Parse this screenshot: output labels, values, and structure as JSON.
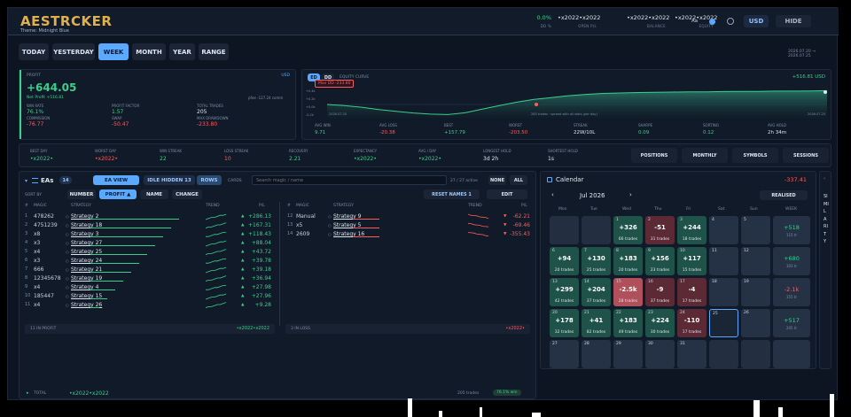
{
  "header": {
    "logo": "AESTRCKER",
    "theme": "Theme: Midnight Blue",
    "stats": [
      {
        "value": "0.0%",
        "label": "DD %",
        "color": "#3ad08a"
      },
      {
        "value": "•x2022•x2022",
        "label": "OPEN P/L",
        "color": "#dfe6f0"
      },
      {
        "value": "•x2022•x2022",
        "label": "BALANCE",
        "color": "#dfe6f0"
      },
      {
        "value": "•x2022•x2022",
        "label": "EQUITY",
        "color": "#dfe6f0"
      }
    ],
    "font_label": "Aa",
    "currency": "USD",
    "hide": "HIDE"
  },
  "periods": [
    "TODAY",
    "YESTERDAY",
    "WEEK",
    "MONTH",
    "YEAR",
    "RANGE"
  ],
  "date_range": "2026.07.20 → 2026.07.25",
  "profit": {
    "label": "PROFIT",
    "currency": "USD",
    "value": "+644.05",
    "net": "Net Profit +516.81",
    "fee": "pfee -127.24 comm",
    "metrics": [
      {
        "label": "WIN RATE",
        "value": "76.1%",
        "color": "#3ad08a"
      },
      {
        "label": "PROFIT FACTOR",
        "value": "1.57",
        "color": "#3ad08a"
      },
      {
        "label": "TOTAL TRADES",
        "value": "205",
        "color": "#dfe6f0"
      },
      {
        "label": "COMMISSION",
        "value": "-76.77",
        "color": "#ff5c5c"
      },
      {
        "label": "SWAP",
        "value": "-50.47",
        "color": "#ff5c5c"
      },
      {
        "label": "MAX DRAWDOWN",
        "value": "-233.80",
        "color": "#ff5c5c"
      }
    ]
  },
  "equity": {
    "tabs": [
      "ED",
      "DD"
    ],
    "title": "EQUITY CURVE",
    "value": "+516.81 USD",
    "maxdd": "Max DD -233.80",
    "yticks": [
      "+0.4k",
      "+0.2k",
      "+0.0k",
      "-0.2k"
    ],
    "x_left": "2026.07.20",
    "x_right": "2026.07.25",
    "note": "265 trades · spread with all stats (per day)",
    "curve": [
      0,
      -0.05,
      -0.12,
      -0.22,
      -0.3,
      -0.37,
      -0.42,
      -0.44,
      -0.36,
      -0.2,
      -0.05,
      0.1,
      0.22,
      0.3,
      0.38,
      0.44,
      0.48,
      0.5,
      0.52,
      0.53,
      0.54,
      0.55,
      0.55,
      0.56,
      0.57,
      0.57,
      0.58,
      0.58,
      0.59,
      0.6
    ],
    "stats": [
      {
        "label": "AVG WIN",
        "value": "9.71",
        "color": "#3ad08a"
      },
      {
        "label": "AVG LOSS",
        "value": "-20.38",
        "color": "#ff5c5c"
      },
      {
        "label": "BEST",
        "value": "+157.79",
        "color": "#3ad08a"
      },
      {
        "label": "WORST",
        "value": "-203.50",
        "color": "#ff5c5c"
      },
      {
        "label": "STREAK",
        "value": "22W/10L",
        "color": "#dfe6f0"
      },
      {
        "label": "SHARPE",
        "value": "0.09",
        "color": "#3ad08a"
      },
      {
        "label": "SORTINO",
        "value": "0.12",
        "color": "#3ad08a"
      },
      {
        "label": "AVG HOLD",
        "value": "2h 34m",
        "color": "#dfe6f0"
      }
    ]
  },
  "summary": [
    {
      "label": "BEST DAY",
      "value": "•x2022•",
      "color": "#3ad08a"
    },
    {
      "label": "WORST DAY",
      "value": "•x2022•",
      "color": "#ff5c5c"
    },
    {
      "label": "WIN STREAK",
      "value": "22",
      "color": "#3ad08a"
    },
    {
      "label": "LOSS STREAK",
      "value": "10",
      "color": "#ff5c5c"
    },
    {
      "label": "RECOVERY",
      "value": "2.21",
      "color": "#3ad08a"
    },
    {
      "label": "EXPECTANCY",
      "value": "•x2022•",
      "color": "#3ad08a"
    },
    {
      "label": "AVG / DAY",
      "value": "•x2022•",
      "color": "#3ad08a"
    },
    {
      "label": "LONGEST HOLD",
      "value": "3d 2h",
      "color": "#dfe6f0"
    },
    {
      "label": "SHORTEST HOLD",
      "value": "1s",
      "color": "#dfe6f0"
    }
  ],
  "summary_buttons": [
    "POSITIONS",
    "MONTHLY",
    "SYMBOLS",
    "SESSIONS"
  ],
  "eas": {
    "title": "EAs",
    "count": "14",
    "ea_view": "EA VIEW",
    "idle": "IDLE HIDDEN 13",
    "rows": "ROWS",
    "cards": "CARDS",
    "search_placeholder": "Search magic / name",
    "active": "27 / 27 active",
    "none": "NONE",
    "all": "ALL",
    "sort_label": "SORT BY",
    "sorts": [
      "NUMBER",
      "PROFIT ▲",
      "NAME",
      "CHANGE"
    ],
    "reset": "RESET NAMES 1",
    "edit": "EDIT",
    "cols": [
      "#",
      "MAGIC",
      "STRATEGY",
      "TREND",
      "P/L"
    ],
    "win": [
      {
        "n": "1",
        "magic": "478262",
        "name": "Strategy 2",
        "pl": "+286.13"
      },
      {
        "n": "2",
        "magic": "4751239",
        "name": "Strategy 18",
        "pl": "+167.31"
      },
      {
        "n": "3",
        "magic": "x8",
        "name": "Strategy 3",
        "pl": "+118.43"
      },
      {
        "n": "4",
        "magic": "x3",
        "name": "Strategy 27",
        "pl": "+88.04"
      },
      {
        "n": "5",
        "magic": "x4",
        "name": "Strategy 25",
        "pl": "+43.72"
      },
      {
        "n": "6",
        "magic": "x3",
        "name": "Strategy 24",
        "pl": "+39.78"
      },
      {
        "n": "7",
        "magic": "666",
        "name": "Strategy 21",
        "pl": "+39.18"
      },
      {
        "n": "8",
        "magic": "12345678",
        "name": "Strategy 19",
        "pl": "+36.94"
      },
      {
        "n": "9",
        "magic": "x4",
        "name": "Strategy 4",
        "pl": "+27.98"
      },
      {
        "n": "10",
        "magic": "185447",
        "name": "Strategy 15",
        "pl": "+27.96"
      },
      {
        "n": "11",
        "magic": "x4",
        "name": "Strategy 26",
        "pl": "+9.28"
      }
    ],
    "loss": [
      {
        "n": "12",
        "magic": "Manual",
        "name": "Strategy 9",
        "pl": "-62.21"
      },
      {
        "n": "13",
        "magic": "x5",
        "name": "Strategy 5",
        "pl": "-69.46"
      },
      {
        "n": "14",
        "magic": "2609",
        "name": "Strategy 16",
        "pl": "-355.43"
      }
    ],
    "in_profit": "11 IN PROFIT",
    "in_profit_val": "•x2022•x2022",
    "in_loss": "3 IN LOSS",
    "in_loss_val": "•x2022•",
    "total": "TOTAL",
    "total_val": "•x2022•x2022",
    "total_trades": "205 trades",
    "total_win": "76.1% win"
  },
  "calendar": {
    "title": "Calendar",
    "value": "-337.41",
    "month": "Jul 2026",
    "realised": "REALISED",
    "days": [
      "Mon",
      "Tue",
      "Wed",
      "Thu",
      "Fri",
      "Sat",
      "Sun",
      "WEEK"
    ],
    "weeks": [
      [
        {
          "d": "",
          "t": "x"
        },
        {
          "d": "",
          "t": "x"
        },
        {
          "d": "1",
          "p": "+326",
          "n": "66 trades",
          "t": "g"
        },
        {
          "d": "2",
          "p": "-51",
          "n": "31 trades",
          "t": "r"
        },
        {
          "d": "3",
          "p": "+244",
          "n": "18 trades",
          "t": "g"
        },
        {
          "d": "4",
          "t": "e"
        },
        {
          "d": "5",
          "t": "e"
        },
        {
          "w": "+518",
          "s": "115 tr",
          "c": "#3ad08a"
        }
      ],
      [
        {
          "d": "6",
          "p": "+94",
          "n": "20 trades",
          "t": "g"
        },
        {
          "d": "7",
          "p": "+130",
          "n": "25 trades",
          "t": "g"
        },
        {
          "d": "8",
          "p": "+183",
          "n": "20 trades",
          "t": "g"
        },
        {
          "d": "9",
          "p": "+156",
          "n": "23 trades",
          "t": "g"
        },
        {
          "d": "10",
          "p": "+117",
          "n": "15 trades",
          "t": "g"
        },
        {
          "d": "11",
          "t": "e"
        },
        {
          "d": "12",
          "t": "e"
        },
        {
          "w": "+680",
          "s": "103 tr",
          "c": "#3ad08a"
        }
      ],
      [
        {
          "d": "13",
          "p": "+299",
          "n": "42 trades",
          "t": "g"
        },
        {
          "d": "14",
          "p": "+204",
          "n": "37 trades",
          "t": "g"
        },
        {
          "d": "15",
          "p": "-2.5k",
          "n": "28 trades",
          "t": "p"
        },
        {
          "d": "16",
          "p": "-9",
          "n": "37 trades",
          "t": "r"
        },
        {
          "d": "17",
          "p": "-4",
          "n": "17 trades",
          "t": "r"
        },
        {
          "d": "18",
          "t": "e"
        },
        {
          "d": "19",
          "t": "e"
        },
        {
          "w": "-2.1k",
          "s": "155 tr",
          "c": "#ff5c5c"
        }
      ],
      [
        {
          "d": "20",
          "p": "+178",
          "n": "32 trades",
          "t": "g"
        },
        {
          "d": "21",
          "p": "+41",
          "n": "82 trades",
          "t": "g"
        },
        {
          "d": "22",
          "p": "+183",
          "n": "49 trades",
          "t": "g"
        },
        {
          "d": "23",
          "p": "+224",
          "n": "30 trades",
          "t": "g"
        },
        {
          "d": "24",
          "p": "-110",
          "n": "17 trades",
          "t": "r"
        },
        {
          "d": "25",
          "t": "sel"
        },
        {
          "d": "26",
          "t": "e"
        },
        {
          "w": "+517",
          "s": "205 tr",
          "c": "#3ad08a"
        }
      ],
      [
        {
          "d": "27",
          "t": "e"
        },
        {
          "d": "28",
          "t": "e"
        },
        {
          "d": "29",
          "t": "e"
        },
        {
          "d": "30",
          "t": "e"
        },
        {
          "d": "31",
          "t": "e"
        },
        {
          "d": "",
          "t": "x"
        },
        {
          "d": "",
          "t": "x"
        },
        {
          "w": "",
          "s": "",
          "c": "#3ad08a"
        }
      ]
    ]
  },
  "similarity": "SIMILARITY"
}
